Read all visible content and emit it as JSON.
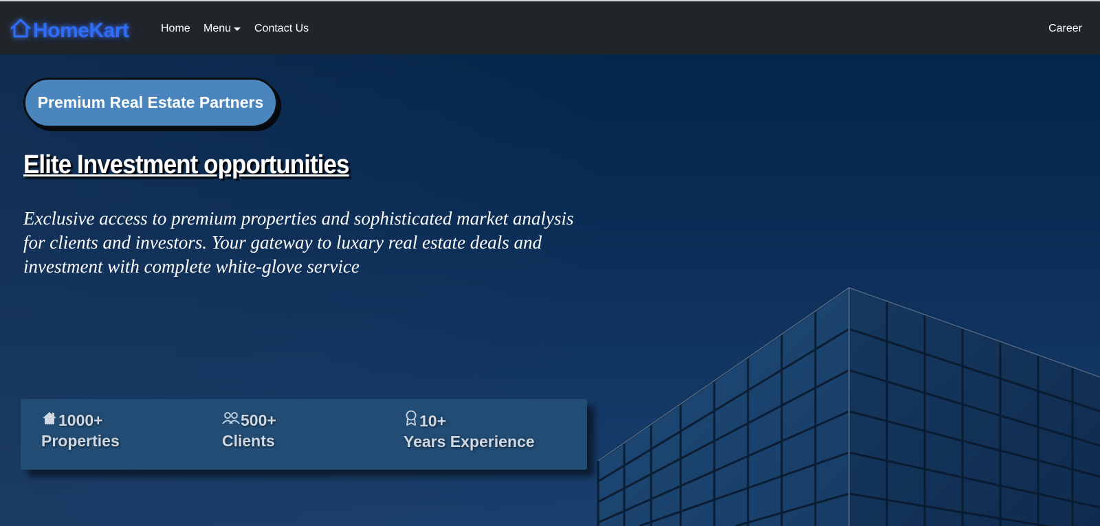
{
  "brand": {
    "name": "HomeKart",
    "icon": "house-icon",
    "color": "#2f6df6"
  },
  "nav": {
    "home": "Home",
    "menu": "Menu",
    "contact": "Contact Us",
    "career": "Career"
  },
  "hero": {
    "badge": "Premium Real Estate Partners",
    "headline": "Elite Investment opportunities",
    "subtext": "Exclusive access to premium properties and sophisticated market analysis for clients and investors. Your gateway to luxary real estate deals and investment with complete white-glove service"
  },
  "stats": [
    {
      "icon": "house-icon",
      "value": "1000+",
      "label": "Properties"
    },
    {
      "icon": "people-icon",
      "value": "500+",
      "label": "Clients"
    },
    {
      "icon": "award-icon",
      "value": "10+",
      "label": "Years Experience"
    }
  ],
  "colors": {
    "navbar": "#212529",
    "badge": "#4a86bd",
    "hero_bg": "#0b2a4f"
  }
}
